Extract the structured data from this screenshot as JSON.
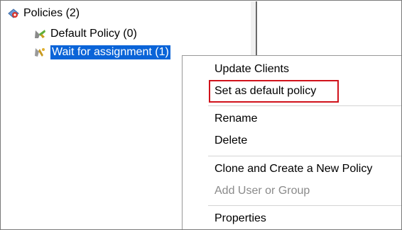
{
  "tree": {
    "root": {
      "label": "Policies (2)",
      "icon": "policies-icon"
    },
    "children": [
      {
        "label": "Default Policy (0)",
        "icon": "default-policy-icon"
      },
      {
        "label": "Wait for assignment (1)",
        "icon": "wait-policy-icon",
        "selected": true
      }
    ]
  },
  "context_menu": {
    "items": [
      {
        "label": "Update Clients",
        "enabled": true
      },
      {
        "label": "Set as default policy",
        "enabled": true,
        "highlighted": true
      },
      {
        "label": "Rename",
        "enabled": true
      },
      {
        "label": "Delete",
        "enabled": true
      },
      {
        "label": "Clone and Create a New Policy",
        "enabled": true
      },
      {
        "label": "Add User or Group",
        "enabled": false
      },
      {
        "label": "Properties",
        "enabled": true
      }
    ]
  },
  "colors": {
    "selection": "#0a64d8",
    "highlight_box": "#d0121b",
    "disabled_text": "#8a8a8a"
  }
}
